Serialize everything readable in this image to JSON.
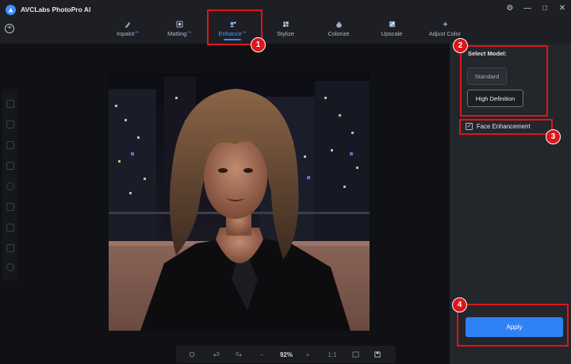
{
  "app": {
    "title": "AVCLabs PhotoPro AI"
  },
  "window_controls": {
    "settings": "⚙",
    "minimize": "—",
    "maximize": "□",
    "close": "✕"
  },
  "toolbar": {
    "add_glyph": "+",
    "tabs": [
      {
        "label": "Inpaint",
        "ai": "AI"
      },
      {
        "label": "Matting",
        "ai": "AI"
      },
      {
        "label": "Enhance",
        "ai": "AI",
        "active": true
      },
      {
        "label": "Stylize"
      },
      {
        "label": "Colorize"
      },
      {
        "label": "Upscale"
      },
      {
        "label": "Adjust Color"
      }
    ]
  },
  "bottom_bar": {
    "zoom": "92%",
    "minus": "−",
    "plus": "+",
    "one_to_one": "1:1"
  },
  "panel": {
    "select_model_label": "Select Model:",
    "models": [
      {
        "label": "Standard",
        "selected": false
      },
      {
        "label": "High Definition",
        "selected": true
      }
    ],
    "face_enhancement": {
      "label": "Face Enhancement",
      "checked": true,
      "check_glyph": "✓"
    },
    "apply_label": "Apply"
  },
  "annotations": [
    "1",
    "2",
    "3",
    "4"
  ],
  "colors": {
    "accent": "#3c8dff",
    "annotation": "#e0141b",
    "apply": "#2f82f5"
  },
  "icons": [
    "app-logo-icon",
    "add-icon",
    "inpaint-icon",
    "matting-icon",
    "enhance-icon",
    "stylize-icon",
    "colorize-icon",
    "upscale-icon",
    "adjust-color-icon",
    "undo-icon",
    "redo-icon",
    "save-icon"
  ]
}
